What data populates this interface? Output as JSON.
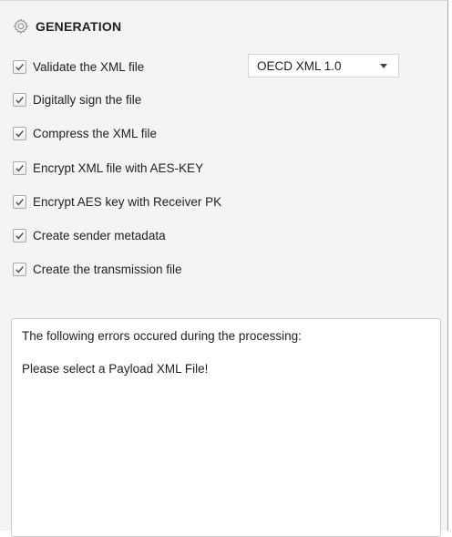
{
  "section": {
    "title": "GENERATION",
    "icon": "gear-icon"
  },
  "options": [
    {
      "label": "Validate the XML file",
      "checked": true
    },
    {
      "label": "Digitally sign the file",
      "checked": true
    },
    {
      "label": "Compress the XML file",
      "checked": true
    },
    {
      "label": "Encrypt XML file with AES-KEY",
      "checked": true
    },
    {
      "label": "Encrypt AES key with Receiver PK",
      "checked": true
    },
    {
      "label": "Create sender metadata",
      "checked": true
    },
    {
      "label": "Create the transmission file",
      "checked": true
    }
  ],
  "format_select": {
    "value": "OECD XML 1.0"
  },
  "messages": {
    "heading": "The following errors occured during the processing:",
    "error": "Please select a Payload XML File!"
  },
  "colors": {
    "panel_background": "#f4f4f4",
    "check_color": "#4a4a4a",
    "right_border": "#8fb89a"
  }
}
